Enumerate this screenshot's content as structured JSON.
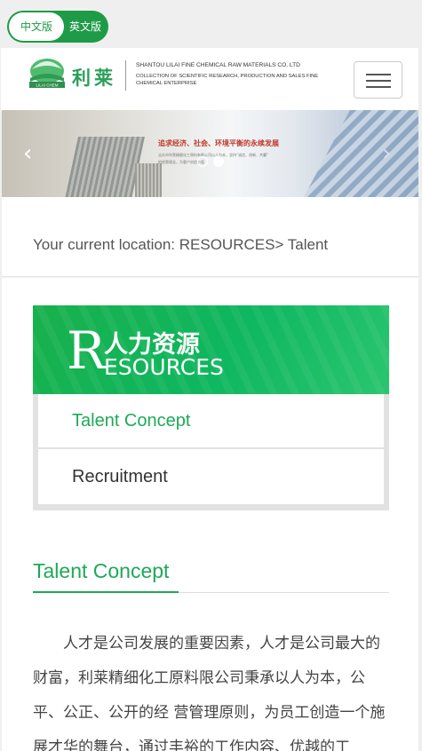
{
  "language_switch": {
    "chinese_label": "中文版",
    "english_label": "英文版"
  },
  "header": {
    "logo_badge_text": "LILAI CHEM",
    "logo_chinese": "利莱",
    "company_name_en": "SHANTOU LILAI FINE CHEMICAL RAW MATERIALS CO. LTD",
    "company_tagline": "COLLECTION OF SCIENTIFIC RESEARCH, PRODUCTION AND SALES FINE CHEMICAL ENTERPRISE"
  },
  "banner": {
    "headline": "追求经济、社会、环境平衡的永续发展",
    "subline_1": "汕头市利莱精细化工原料有限公司以人为本，坚持“诚信、创新、共赢”",
    "subline_2": "的经营理念，为客户创造价值",
    "prev_label": "‹",
    "next_label": "›",
    "slide_count": 2,
    "active_slide": 2
  },
  "location": {
    "text": "Your current location:   RESOURCES> Talent"
  },
  "sidebar": {
    "header_cn": "人力资源",
    "header_en_initial": "R",
    "header_en_rest": "ESOURCES",
    "items": [
      {
        "label": "Talent Concept",
        "active": true
      },
      {
        "label": "Recruitment",
        "active": false
      }
    ]
  },
  "content": {
    "title": "Talent Concept",
    "paragraph": "人才是公司发展的重要因素，人才是公司最大的财富，利莱精细化工原料限公司秉承以人为本，公平、公正、公开的经 营管理原则，为员工创造一个施展才华的舞台，通过丰裕的工作内容、优越的工"
  },
  "colors": {
    "brand_green": "#1fa957",
    "lang_toggle_green": "#1e9b47"
  }
}
